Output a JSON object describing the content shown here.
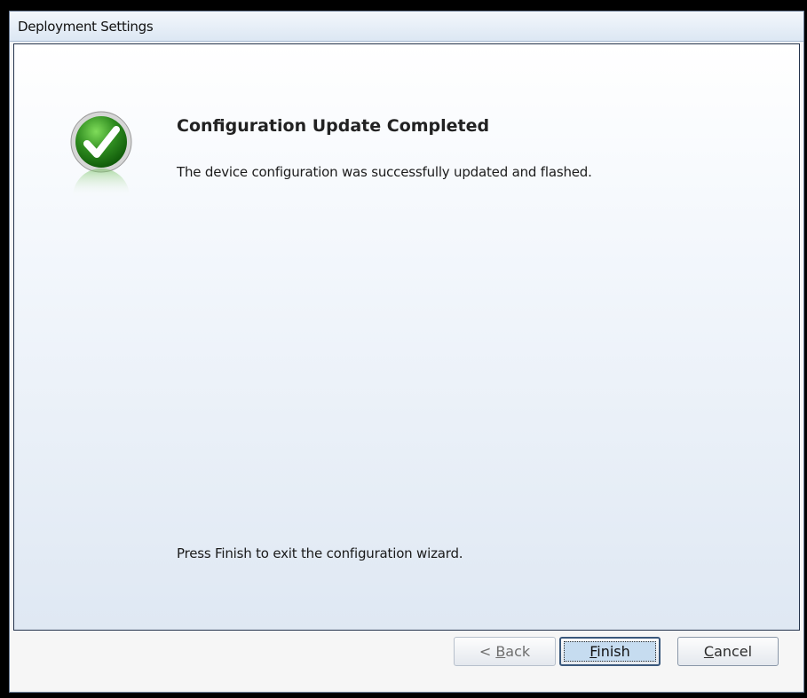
{
  "window": {
    "title": "Deployment Settings"
  },
  "content": {
    "icon": "success-check-icon",
    "heading": "Configuration Update Completed",
    "message": "The device configuration was successfully updated and flashed.",
    "hint": "Press Finish to exit the configuration wizard."
  },
  "buttons": {
    "back": {
      "prefix": "< ",
      "mnemonic": "B",
      "rest": "ack",
      "enabled": false
    },
    "finish": {
      "prefix": "",
      "mnemonic": "F",
      "rest": "inish",
      "focused": true
    },
    "cancel": {
      "prefix": "",
      "mnemonic": "C",
      "rest": "ancel"
    }
  },
  "colors": {
    "check_green": "#2e8b1f",
    "panel_border": "#25344d",
    "focus_fill": "#c6dcf0"
  }
}
